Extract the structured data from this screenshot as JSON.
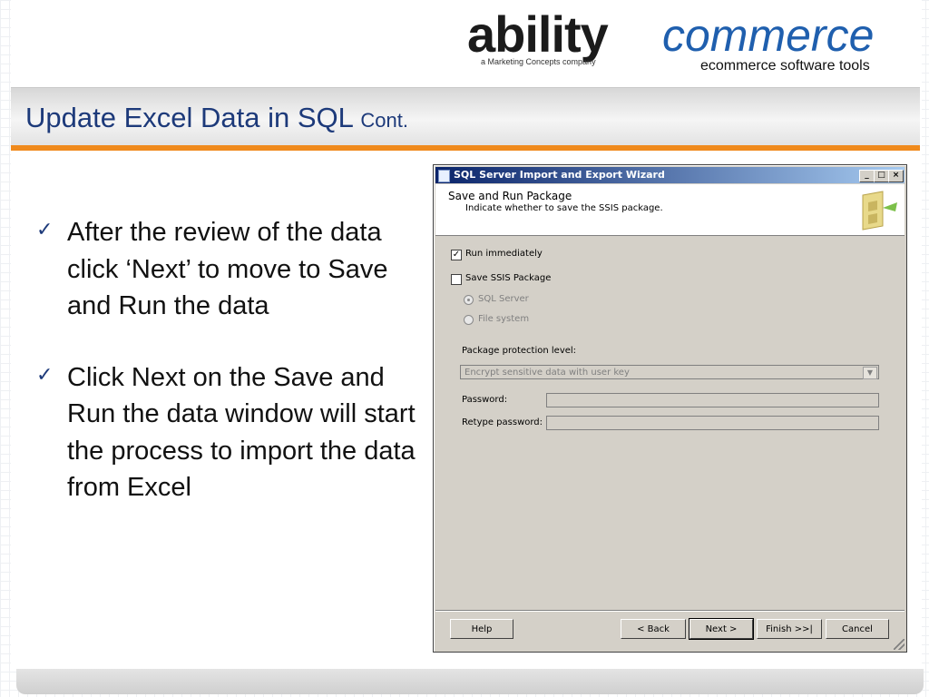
{
  "logo": {
    "brand_part1": "ability",
    "brand_part2": "commerce",
    "tagline": "a Marketing Concepts company",
    "subtitle": "ecommerce software tools"
  },
  "slide": {
    "title_main": "Update Excel Data in SQL",
    "title_small": "Cont.",
    "bullets": [
      {
        "text": "After the review of the data click ‘Next’ to move to Save and Run the data"
      },
      {
        "text": "Click Next on the Save and Run the data window will start the process to import the data from Excel"
      }
    ],
    "bullet_icon": "checkmark-icon"
  },
  "wizard": {
    "window_title": "SQL Server Import and Export Wizard",
    "caption_buttons": {
      "minimize": "_",
      "maximize": "□",
      "close": "×"
    },
    "header": {
      "title": "Save and Run Package",
      "subtitle": "Indicate whether to save the SSIS package."
    },
    "run_immediately": {
      "label": "Run immediately",
      "checked": true
    },
    "save_ssis": {
      "label": "Save SSIS Package",
      "checked": false
    },
    "radio_sql_server": {
      "label": "SQL Server",
      "selected": true,
      "enabled": false
    },
    "radio_file_system": {
      "label": "File system",
      "selected": false,
      "enabled": false
    },
    "protection_label": "Package protection level:",
    "protection_value": "Encrypt sensitive data with user key",
    "password_label": "Password:",
    "retype_label": "Retype password:",
    "buttons": {
      "help": "Help",
      "back": "< Back",
      "next": "Next >",
      "finish": "Finish >>|",
      "cancel": "Cancel"
    }
  },
  "colors": {
    "title_text": "#1d3a7a",
    "accent_orange": "#f08a1c",
    "logo_blue": "#1f5fae",
    "titlebar_start": "#0a246a",
    "titlebar_end": "#a6caf0",
    "dialog_face": "#d4d0c8"
  }
}
